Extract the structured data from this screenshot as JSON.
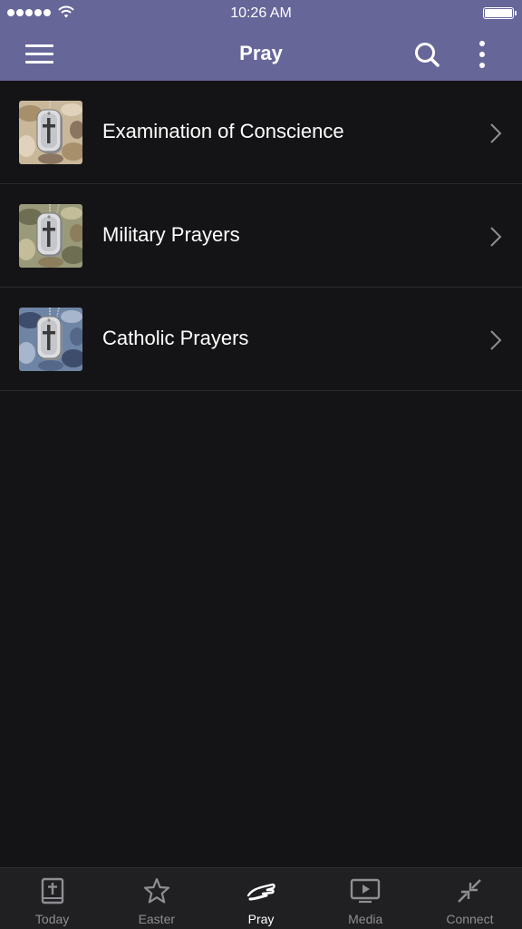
{
  "status_bar": {
    "time": "10:26 AM",
    "signal_icon": "signal-dots-icon",
    "wifi_icon": "wifi-icon",
    "battery_icon": "battery-icon"
  },
  "nav": {
    "title": "Pray",
    "menu_icon": "hamburger-menu-icon",
    "search_icon": "search-icon",
    "more_icon": "vertical-ellipsis-icon"
  },
  "list": [
    {
      "label": "Examination of Conscience",
      "thumb": "desert-camo-dogtag-cross",
      "camo_colors": [
        "#c9b79a",
        "#a88f6c",
        "#e0d2bb",
        "#8a7560"
      ]
    },
    {
      "label": "Military Prayers",
      "thumb": "woodland-camo-dogtag-cross",
      "camo_colors": [
        "#9a9a7a",
        "#6e6f52",
        "#c3bd9a",
        "#8c7e5c"
      ]
    },
    {
      "label": "Catholic Prayers",
      "thumb": "navy-camo-dogtag-cross",
      "camo_colors": [
        "#6f85a6",
        "#3d4d6b",
        "#a7b6cc",
        "#55688a"
      ]
    }
  ],
  "tabs": [
    {
      "label": "Today",
      "icon": "bible-cross-icon",
      "active": false
    },
    {
      "label": "Easter",
      "icon": "star-outline-icon",
      "active": false
    },
    {
      "label": "Pray",
      "icon": "praying-hands-icon",
      "active": true
    },
    {
      "label": "Media",
      "icon": "play-screen-icon",
      "active": false
    },
    {
      "label": "Connect",
      "icon": "connect-arrows-icon",
      "active": false
    }
  ],
  "colors": {
    "header": "#676699",
    "background": "#141416",
    "tab_bar": "#202022",
    "tab_inactive": "#8e8e93",
    "tab_active": "#ffffff"
  }
}
